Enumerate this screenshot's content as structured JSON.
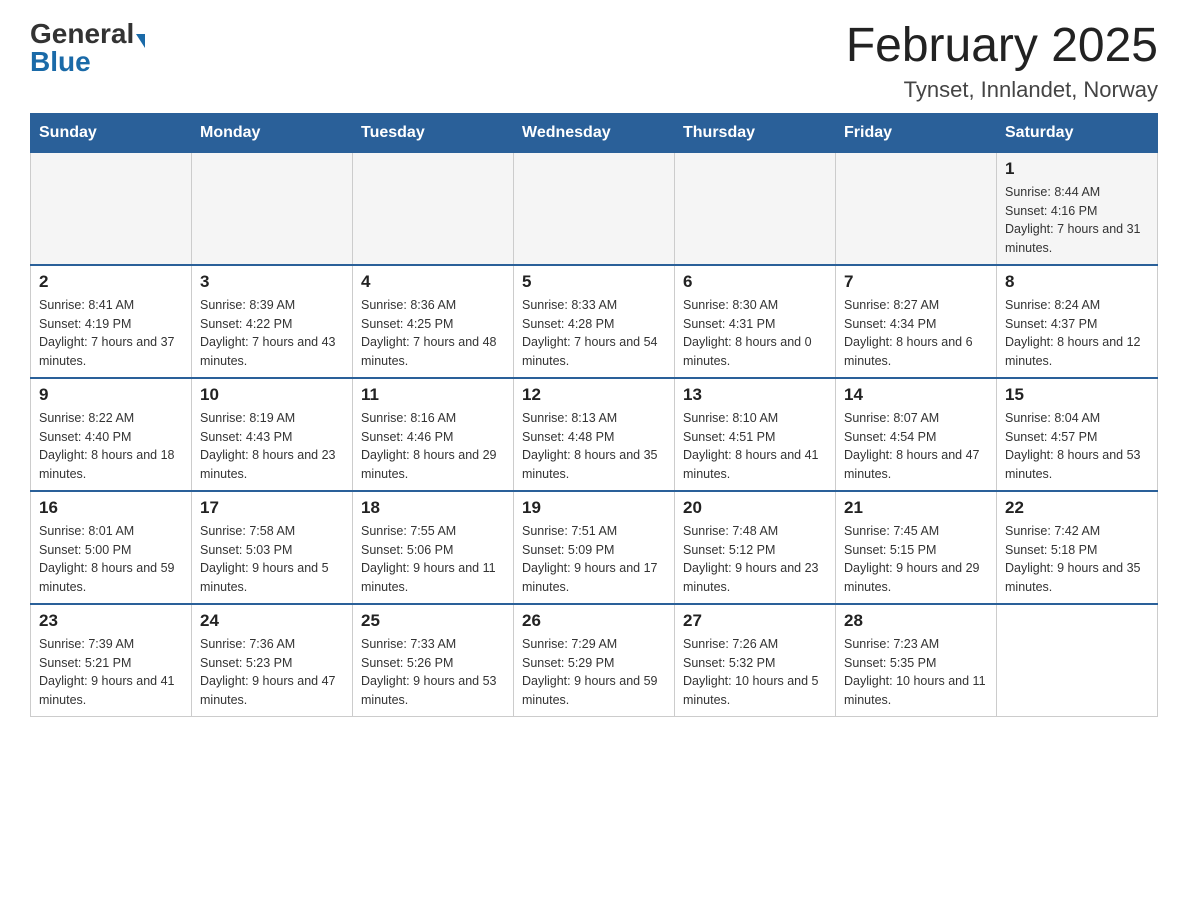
{
  "header": {
    "logo_general": "General",
    "logo_blue": "Blue",
    "month_title": "February 2025",
    "location": "Tynset, Innlandet, Norway"
  },
  "weekdays": [
    "Sunday",
    "Monday",
    "Tuesday",
    "Wednesday",
    "Thursday",
    "Friday",
    "Saturday"
  ],
  "weeks": [
    [
      {
        "day": "",
        "sunrise": "",
        "sunset": "",
        "daylight": ""
      },
      {
        "day": "",
        "sunrise": "",
        "sunset": "",
        "daylight": ""
      },
      {
        "day": "",
        "sunrise": "",
        "sunset": "",
        "daylight": ""
      },
      {
        "day": "",
        "sunrise": "",
        "sunset": "",
        "daylight": ""
      },
      {
        "day": "",
        "sunrise": "",
        "sunset": "",
        "daylight": ""
      },
      {
        "day": "",
        "sunrise": "",
        "sunset": "",
        "daylight": ""
      },
      {
        "day": "1",
        "sunrise": "Sunrise: 8:44 AM",
        "sunset": "Sunset: 4:16 PM",
        "daylight": "Daylight: 7 hours and 31 minutes."
      }
    ],
    [
      {
        "day": "2",
        "sunrise": "Sunrise: 8:41 AM",
        "sunset": "Sunset: 4:19 PM",
        "daylight": "Daylight: 7 hours and 37 minutes."
      },
      {
        "day": "3",
        "sunrise": "Sunrise: 8:39 AM",
        "sunset": "Sunset: 4:22 PM",
        "daylight": "Daylight: 7 hours and 43 minutes."
      },
      {
        "day": "4",
        "sunrise": "Sunrise: 8:36 AM",
        "sunset": "Sunset: 4:25 PM",
        "daylight": "Daylight: 7 hours and 48 minutes."
      },
      {
        "day": "5",
        "sunrise": "Sunrise: 8:33 AM",
        "sunset": "Sunset: 4:28 PM",
        "daylight": "Daylight: 7 hours and 54 minutes."
      },
      {
        "day": "6",
        "sunrise": "Sunrise: 8:30 AM",
        "sunset": "Sunset: 4:31 PM",
        "daylight": "Daylight: 8 hours and 0 minutes."
      },
      {
        "day": "7",
        "sunrise": "Sunrise: 8:27 AM",
        "sunset": "Sunset: 4:34 PM",
        "daylight": "Daylight: 8 hours and 6 minutes."
      },
      {
        "day": "8",
        "sunrise": "Sunrise: 8:24 AM",
        "sunset": "Sunset: 4:37 PM",
        "daylight": "Daylight: 8 hours and 12 minutes."
      }
    ],
    [
      {
        "day": "9",
        "sunrise": "Sunrise: 8:22 AM",
        "sunset": "Sunset: 4:40 PM",
        "daylight": "Daylight: 8 hours and 18 minutes."
      },
      {
        "day": "10",
        "sunrise": "Sunrise: 8:19 AM",
        "sunset": "Sunset: 4:43 PM",
        "daylight": "Daylight: 8 hours and 23 minutes."
      },
      {
        "day": "11",
        "sunrise": "Sunrise: 8:16 AM",
        "sunset": "Sunset: 4:46 PM",
        "daylight": "Daylight: 8 hours and 29 minutes."
      },
      {
        "day": "12",
        "sunrise": "Sunrise: 8:13 AM",
        "sunset": "Sunset: 4:48 PM",
        "daylight": "Daylight: 8 hours and 35 minutes."
      },
      {
        "day": "13",
        "sunrise": "Sunrise: 8:10 AM",
        "sunset": "Sunset: 4:51 PM",
        "daylight": "Daylight: 8 hours and 41 minutes."
      },
      {
        "day": "14",
        "sunrise": "Sunrise: 8:07 AM",
        "sunset": "Sunset: 4:54 PM",
        "daylight": "Daylight: 8 hours and 47 minutes."
      },
      {
        "day": "15",
        "sunrise": "Sunrise: 8:04 AM",
        "sunset": "Sunset: 4:57 PM",
        "daylight": "Daylight: 8 hours and 53 minutes."
      }
    ],
    [
      {
        "day": "16",
        "sunrise": "Sunrise: 8:01 AM",
        "sunset": "Sunset: 5:00 PM",
        "daylight": "Daylight: 8 hours and 59 minutes."
      },
      {
        "day": "17",
        "sunrise": "Sunrise: 7:58 AM",
        "sunset": "Sunset: 5:03 PM",
        "daylight": "Daylight: 9 hours and 5 minutes."
      },
      {
        "day": "18",
        "sunrise": "Sunrise: 7:55 AM",
        "sunset": "Sunset: 5:06 PM",
        "daylight": "Daylight: 9 hours and 11 minutes."
      },
      {
        "day": "19",
        "sunrise": "Sunrise: 7:51 AM",
        "sunset": "Sunset: 5:09 PM",
        "daylight": "Daylight: 9 hours and 17 minutes."
      },
      {
        "day": "20",
        "sunrise": "Sunrise: 7:48 AM",
        "sunset": "Sunset: 5:12 PM",
        "daylight": "Daylight: 9 hours and 23 minutes."
      },
      {
        "day": "21",
        "sunrise": "Sunrise: 7:45 AM",
        "sunset": "Sunset: 5:15 PM",
        "daylight": "Daylight: 9 hours and 29 minutes."
      },
      {
        "day": "22",
        "sunrise": "Sunrise: 7:42 AM",
        "sunset": "Sunset: 5:18 PM",
        "daylight": "Daylight: 9 hours and 35 minutes."
      }
    ],
    [
      {
        "day": "23",
        "sunrise": "Sunrise: 7:39 AM",
        "sunset": "Sunset: 5:21 PM",
        "daylight": "Daylight: 9 hours and 41 minutes."
      },
      {
        "day": "24",
        "sunrise": "Sunrise: 7:36 AM",
        "sunset": "Sunset: 5:23 PM",
        "daylight": "Daylight: 9 hours and 47 minutes."
      },
      {
        "day": "25",
        "sunrise": "Sunrise: 7:33 AM",
        "sunset": "Sunset: 5:26 PM",
        "daylight": "Daylight: 9 hours and 53 minutes."
      },
      {
        "day": "26",
        "sunrise": "Sunrise: 7:29 AM",
        "sunset": "Sunset: 5:29 PM",
        "daylight": "Daylight: 9 hours and 59 minutes."
      },
      {
        "day": "27",
        "sunrise": "Sunrise: 7:26 AM",
        "sunset": "Sunset: 5:32 PM",
        "daylight": "Daylight: 10 hours and 5 minutes."
      },
      {
        "day": "28",
        "sunrise": "Sunrise: 7:23 AM",
        "sunset": "Sunset: 5:35 PM",
        "daylight": "Daylight: 10 hours and 11 minutes."
      },
      {
        "day": "",
        "sunrise": "",
        "sunset": "",
        "daylight": ""
      }
    ]
  ]
}
